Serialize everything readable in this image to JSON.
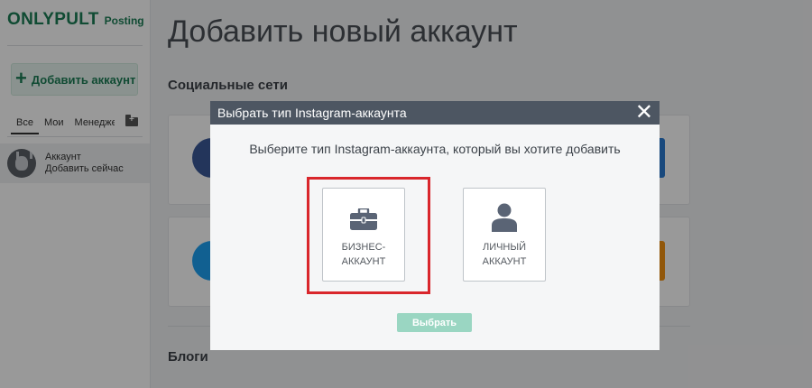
{
  "sidebar": {
    "brand": "ONLYPULT",
    "brand_sub": "Posting",
    "add_button_label": "Добавить аккаунт",
    "filters": [
      "Все",
      "Мои",
      "Менедже"
    ],
    "account": {
      "name": "Аккаунт",
      "action": "Добавить сейчас"
    }
  },
  "main": {
    "title": "Добавить новый аккаунт",
    "section_social": "Социальные сети",
    "section_blogs": "Блоги"
  },
  "modal": {
    "title": "Выбрать тип Instagram-аккаунта",
    "close_glyph": "✕",
    "subtitle": "Выберите тип Instagram-аккаунта, который вы хотите добавить",
    "options": [
      {
        "line1": "БИЗНЕС-",
        "line2": "АККАУНТ",
        "icon": "briefcase-icon",
        "highlighted": true
      },
      {
        "line1": "ЛИЧНЫЙ",
        "line2": "АККАУНТ",
        "icon": "user-icon",
        "highlighted": false
      }
    ],
    "choose_button": "Выбрать"
  },
  "colors": {
    "brand": "#1c7d56",
    "modal_header": "#4d5662",
    "highlight": "#d9262c",
    "choose_button": "#9ad6c2"
  }
}
